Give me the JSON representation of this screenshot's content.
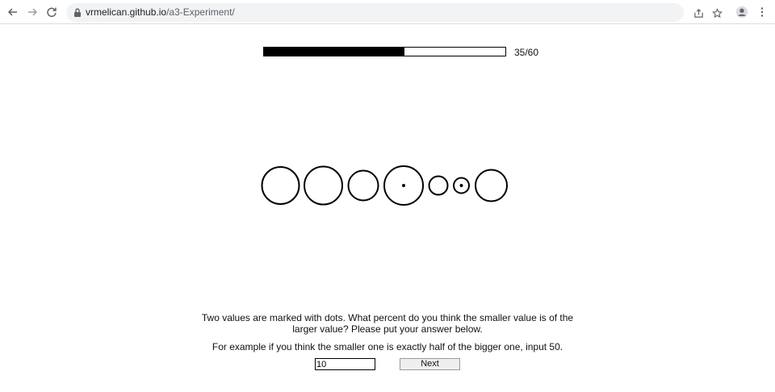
{
  "browser": {
    "url_host": "vrmelican.github.io",
    "url_path": "/a3-Experiment/"
  },
  "progress": {
    "current": 35,
    "total": 60,
    "label": "35/60"
  },
  "stimulus": {
    "type": "bubble chart",
    "marked_indices": [
      3,
      5
    ],
    "circle_count": 7
  },
  "question": {
    "text": "Two values are marked with dots. What percent do you think the smaller value is of the larger value? Please put your answer below.",
    "example": "For example if you think the smaller one is exactly half of the bigger one, input 50."
  },
  "answer": {
    "value": "10"
  },
  "next_button": {
    "label": "Next"
  }
}
